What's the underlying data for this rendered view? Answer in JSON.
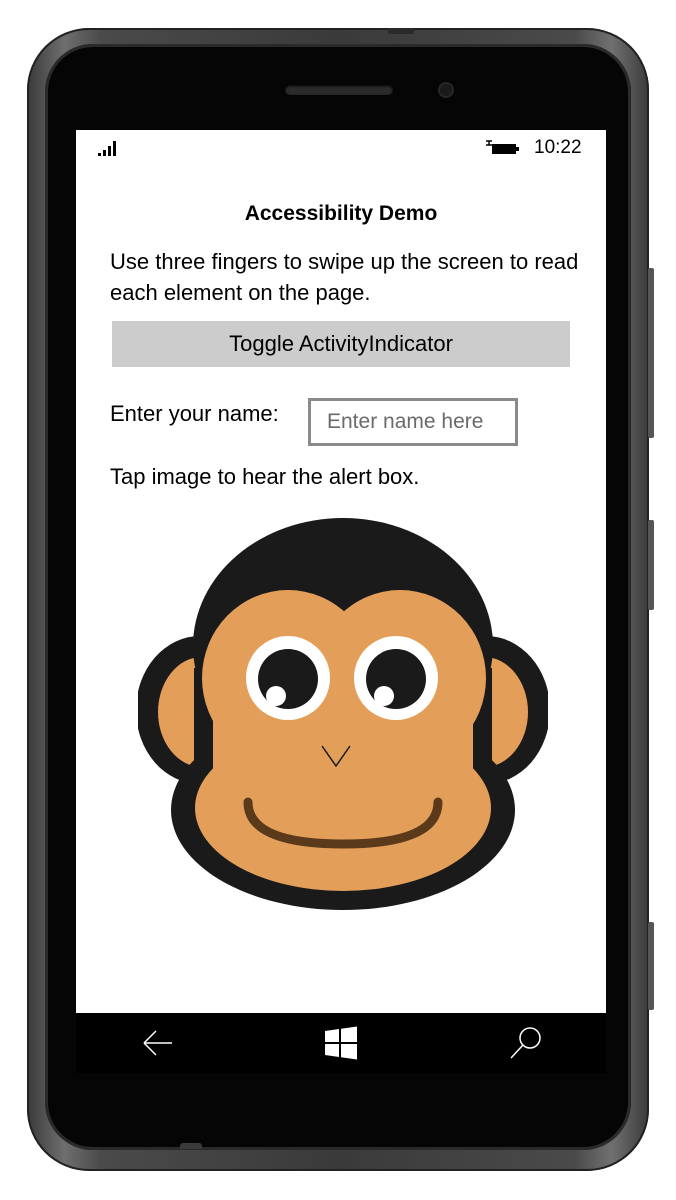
{
  "status_bar": {
    "time": "10:22",
    "signal_icon": "signal-bars-icon",
    "battery_icon": "battery-charging-icon"
  },
  "page": {
    "title": "Accessibility Demo",
    "instructions": "Use three fingers to swipe up the screen to read each element on the page.",
    "toggle_button_label": "Toggle ActivityIndicator",
    "name_label": "Enter your name:",
    "name_placeholder": "Enter name here",
    "name_value": "",
    "tap_hint": "Tap image to hear the alert box."
  },
  "image": {
    "subject": "monkey-face",
    "colors": {
      "outline": "#1a1a1a",
      "skin": "#e39f5a",
      "mouth": "#5a3a1a"
    }
  },
  "nav_bar": {
    "back_icon": "back-arrow-icon",
    "home_icon": "windows-logo-icon",
    "search_icon": "search-icon"
  },
  "device": {
    "frame_color": "#4a4a4a",
    "screen_bg": "#ffffff"
  }
}
